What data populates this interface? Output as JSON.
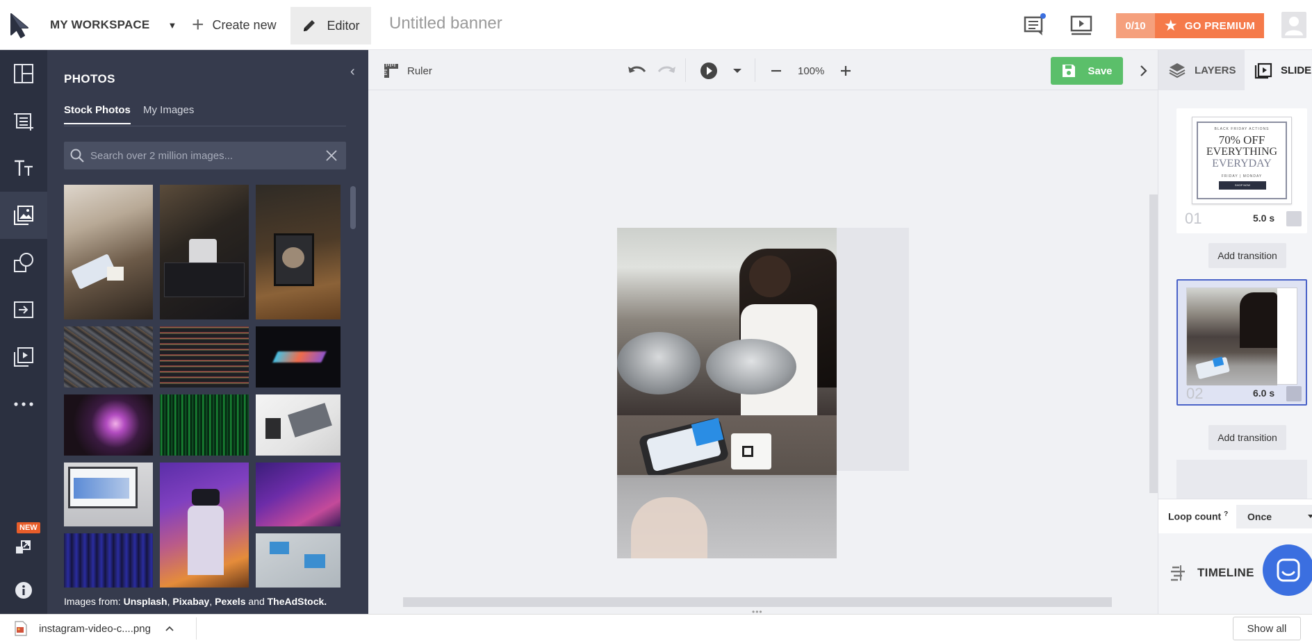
{
  "topbar": {
    "workspace_label": "MY WORKSPACE",
    "create_new_label": "Create new",
    "editor_label": "Editor",
    "banner_title": "Untitled banner",
    "premium_count": "0/10",
    "premium_label": "GO PREMIUM"
  },
  "rail": {
    "items": [
      "layouts-icon",
      "crop-icon",
      "text-icon",
      "photos-icon",
      "shapes-icon",
      "import-icon",
      "slides-icon",
      "more-icon"
    ],
    "new_badge": "NEW"
  },
  "photos_panel": {
    "title": "PHOTOS",
    "tabs": [
      "Stock Photos",
      "My Images"
    ],
    "search_placeholder": "Search over 2 million images...",
    "credits_prefix": "Images from:",
    "credits_sources": [
      "Unsplash",
      "Pixabay",
      "Pexels"
    ],
    "credits_and": "and",
    "credits_last": "TheAdStock."
  },
  "canvas_toolbar": {
    "ruler_label": "Ruler",
    "zoom": "100%",
    "save_label": "Save"
  },
  "right_panel": {
    "tabs": [
      "LAYERS",
      "SLIDE"
    ],
    "slides": [
      {
        "number": "01",
        "duration": "5.0 s",
        "thumb_lines": [
          "BLACK FRIDAY ACTIONS",
          "70% OFF",
          "EVERYTHING",
          "EVERYDAY",
          "FRIDAY | MONDAY",
          "SHOP NOW"
        ]
      },
      {
        "number": "02",
        "duration": "6.0 s"
      }
    ],
    "add_transition_label": "Add transition",
    "loop_label": "Loop count",
    "loop_help": "?",
    "loop_value": "Once",
    "timeline_label": "TIMELINE"
  },
  "download_bar": {
    "file_name": "instagram-video-c....png",
    "show_all": "Show all"
  },
  "colors": {
    "rail_bg": "#2b3040",
    "panel_bg": "#363b4d",
    "save_green": "#5bbf6a",
    "premium_orange": "#f57a4a",
    "selection_blue": "#4a62c8",
    "chat_blue": "#3b6fe0"
  }
}
